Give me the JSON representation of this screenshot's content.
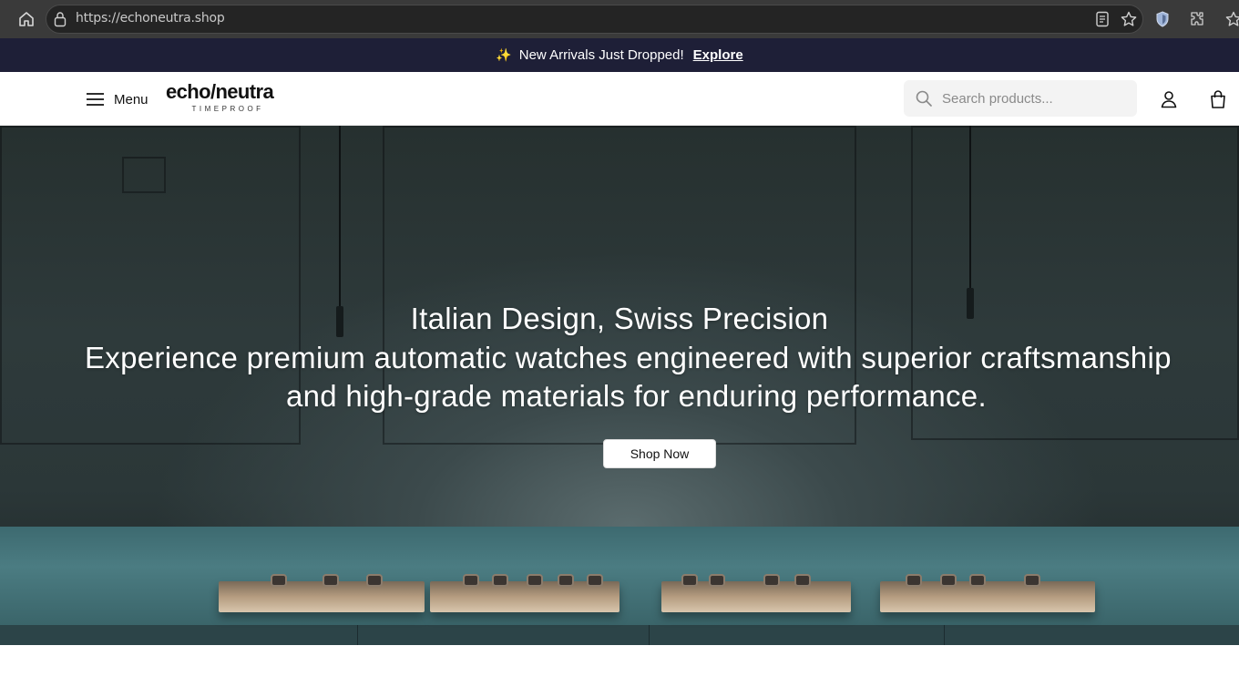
{
  "browser": {
    "url": "https://echoneutra.shop",
    "icons": [
      "home-icon",
      "lock-icon",
      "reader-icon",
      "star-icon",
      "shield-icon",
      "extensions-icon",
      "bookmark-star-icon"
    ]
  },
  "announcement": {
    "icon": "sparkles-icon",
    "icon_glyph": "✨",
    "text": "New Arrivals Just Dropped!",
    "link": "Explore"
  },
  "header": {
    "menu_label": "Menu",
    "logo_main": "echo/neutra",
    "logo_sub": "TIMEPROOF",
    "search_placeholder": "Search products...",
    "icons": [
      "hamburger-icon",
      "search-icon",
      "user-icon",
      "bag-icon"
    ]
  },
  "hero": {
    "title": "Italian Design, Swiss Precision",
    "subtitle_line1": "Experience premium automatic watches engineered with superior craftsmanship",
    "subtitle_line2": "and high-grade materials for enduring performance.",
    "cta": "Shop Now"
  },
  "colors": {
    "browser_bar": "#3a3a3a",
    "announcement_bg": "#1e1f37",
    "hero_counter": "#4b7c82"
  }
}
